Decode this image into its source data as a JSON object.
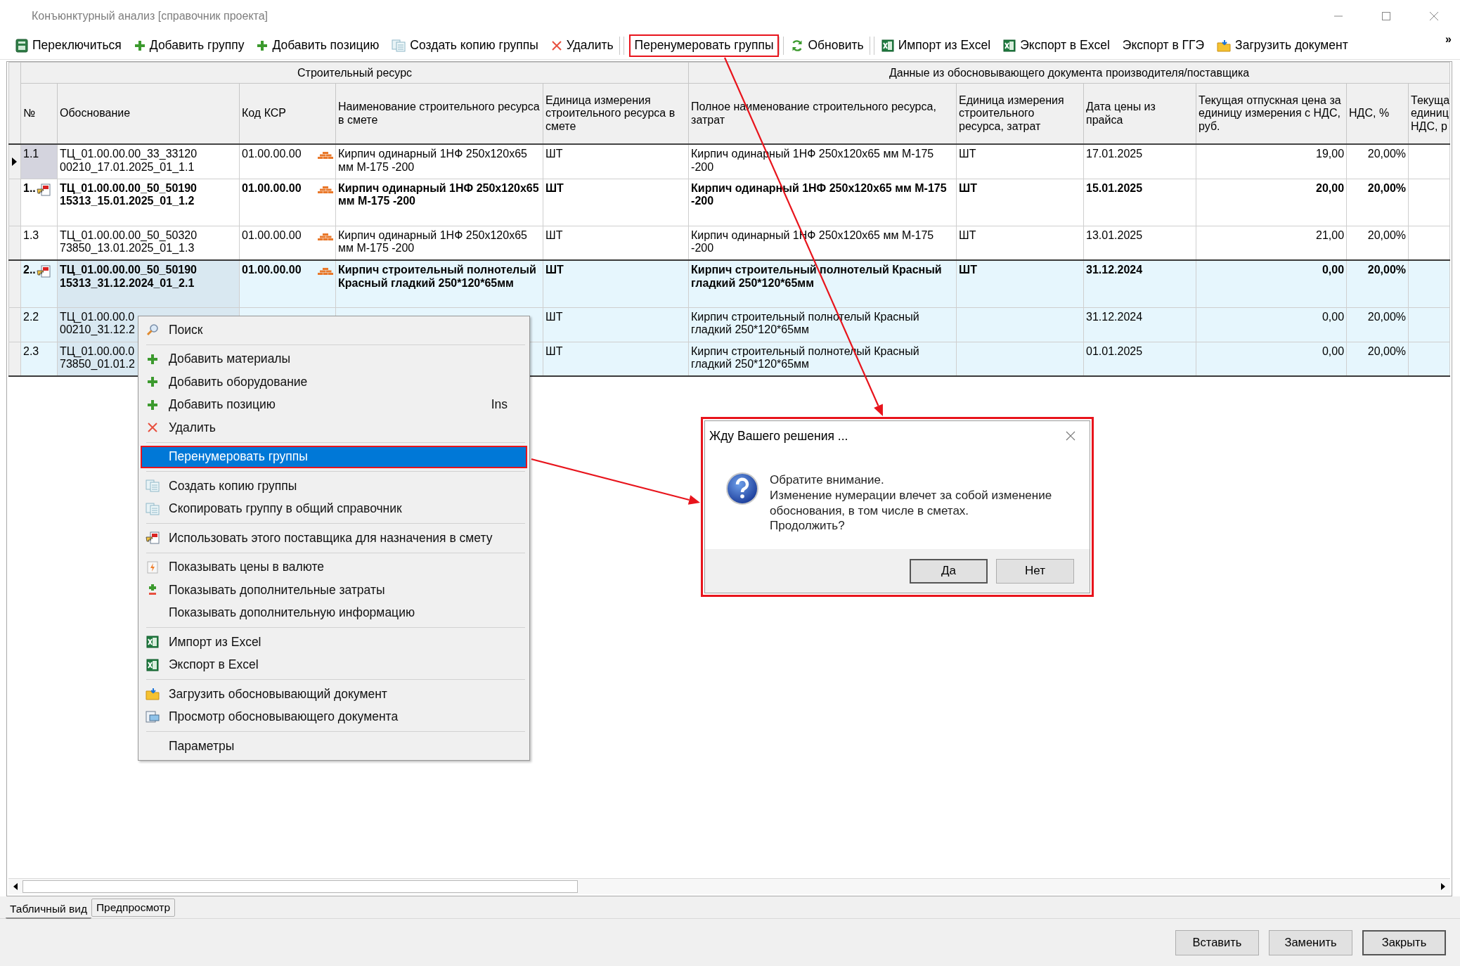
{
  "window": {
    "title": "Конъюнктурный анализ [справочник проекта]"
  },
  "toolbar": {
    "items": [
      {
        "label": "Переключиться",
        "kind": "doc",
        "annotated": false,
        "divider_after": false
      },
      {
        "label": "Добавить группу",
        "kind": "plus",
        "annotated": false,
        "divider_after": false
      },
      {
        "label": "Добавить позицию",
        "kind": "plus",
        "annotated": false,
        "divider_after": false
      },
      {
        "label": "Создать копию группы",
        "kind": "copy",
        "annotated": false,
        "divider_after": false
      },
      {
        "label": "Удалить",
        "kind": "delete",
        "annotated": false,
        "divider_after": true
      },
      {
        "label": "Перенумеровать группы",
        "kind": "text",
        "annotated": true,
        "divider_after": true
      },
      {
        "label": "Обновить",
        "kind": "refresh",
        "annotated": false,
        "divider_after": true
      },
      {
        "label": "Импорт из Excel",
        "kind": "excel",
        "annotated": false,
        "divider_after": false
      },
      {
        "label": "Экспорт в Excel",
        "kind": "excel",
        "annotated": false,
        "divider_after": false
      },
      {
        "label": "Экспорт в ГГЭ",
        "kind": "text",
        "annotated": false,
        "divider_after": false
      },
      {
        "label": "Загрузить документ",
        "kind": "folder",
        "annotated": false,
        "divider_after": false
      }
    ],
    "overflow": "»"
  },
  "table": {
    "column_groups": [
      {
        "label": "Строительный ресурс",
        "columns": [
          "№",
          "Обоснование",
          "Код КСР",
          "Наименование строительного ресурса в смете",
          "Единица измерения строительного ресурса в смете"
        ]
      },
      {
        "label": "Данные из обосновывающего документа производителя/поставщика",
        "columns": [
          "Полное наименование строительного ресурса, затрат",
          "Единица измерения строительного ресурса, затрат",
          "Дата цены из прайса",
          "Текущая отпускная цена за единицу измерения с НДС, руб.",
          "НДС, %",
          "Текуща единиц НДС, р"
        ]
      }
    ],
    "groups": [
      {
        "selected": false,
        "rows": [
          {
            "number": "1.1",
            "current": true,
            "chosen": false,
            "basis": [
              "ТЦ_01.00.00.00_33_33120",
              "00210_17.01.2025_01_1.1"
            ],
            "code": "01.00.00.00",
            "name": "Кирпич одинарный 1НФ 250x120x65 мм М-175 -200",
            "unit": "ШТ",
            "full_name": "Кирпич одинарный 1НФ 250x120x65 мм М-175 -200",
            "unit_2": "ШТ",
            "price_date": "17.01.2025",
            "price": "19,00",
            "vat": "20,00%"
          },
          {
            "number": "1..",
            "current": false,
            "chosen": true,
            "basis": [
              "ТЦ_01.00.00.00_50_50190",
              "15313_15.01.2025_01_1.2"
            ],
            "code": "01.00.00.00",
            "name": "Кирпич одинарный 1НФ 250x120x65 мм М-175 -200",
            "unit": "ШТ",
            "full_name": "Кирпич одинарный 1НФ 250x120x65 мм М-175 -200",
            "unit_2": "ШТ",
            "price_date": "15.01.2025",
            "price": "20,00",
            "vat": "20,00%"
          },
          {
            "number": "1.3",
            "current": false,
            "chosen": false,
            "basis": [
              "ТЦ_01.00.00.00_50_50320",
              "73850_13.01.2025_01_1.3"
            ],
            "code": "01.00.00.00",
            "name": "Кирпич одинарный 1НФ 250x120x65 мм М-175 -200",
            "unit": "ШТ",
            "full_name": "Кирпич одинарный 1НФ 250x120x65 мм М-175 -200",
            "unit_2": "ШТ",
            "price_date": "13.01.2025",
            "price": "21,00",
            "vat": "20,00%"
          }
        ]
      },
      {
        "selected": true,
        "rows": [
          {
            "number": "2..",
            "current": false,
            "chosen": true,
            "basis": [
              "ТЦ_01.00.00.00_50_50190",
              "15313_31.12.2024_01_2.1"
            ],
            "code": "01.00.00.00",
            "name": "Кирпич строительный полнотелый Красный гладкий 250*120*65мм",
            "unit": "ШТ",
            "full_name": "Кирпич строительный полнотелый Красный гладкий 250*120*65мм",
            "unit_2": "ШТ",
            "price_date": "31.12.2024",
            "price": "0,00",
            "vat": "20,00%"
          },
          {
            "number": "2.2",
            "current": false,
            "chosen": false,
            "basis": [
              "ТЦ_01.00.00.0",
              "00210_31.12.2"
            ],
            "unit": "ШТ",
            "full_name": "Кирпич строительный полнотелый Красный гладкий 250*120*65мм",
            "price_date": "31.12.2024",
            "price": "0,00",
            "vat": "20,00%"
          },
          {
            "number": "2.3",
            "current": false,
            "chosen": false,
            "basis": [
              "ТЦ_01.00.00.0",
              "73850_01.01.2"
            ],
            "unit": "ШТ",
            "full_name": "Кирпич строительный полнотелый Красный гладкий 250*120*65мм",
            "price_date": "01.01.2025",
            "price": "0,00",
            "vat": "20,00%"
          }
        ]
      }
    ]
  },
  "context_menu": {
    "sections": [
      [
        {
          "label": "Поиск",
          "kind": "search",
          "selected": false,
          "annotated": false
        }
      ],
      [
        {
          "label": "Добавить материалы",
          "kind": "plus",
          "selected": false,
          "annotated": false
        },
        {
          "label": "Добавить оборудование",
          "kind": "plus",
          "selected": false,
          "annotated": false
        },
        {
          "label": "Добавить позицию",
          "kind": "plus",
          "selected": false,
          "annotated": false,
          "shortcut": "Ins"
        },
        {
          "label": "Удалить",
          "kind": "delete",
          "selected": false,
          "annotated": false
        }
      ],
      [
        {
          "label": "Перенумеровать группы",
          "kind": "text",
          "selected": true,
          "annotated": true
        }
      ],
      [
        {
          "label": "Создать копию группы",
          "kind": "copy",
          "selected": false,
          "annotated": false
        },
        {
          "label": "Скопировать группу в общий справочник",
          "kind": "copy",
          "selected": false,
          "annotated": false
        }
      ],
      [
        {
          "label": "Использовать этого поставщика для назначения в смету",
          "kind": "hand",
          "selected": false,
          "annotated": false
        }
      ],
      [
        {
          "label": "Показывать цены в валюте",
          "kind": "currency",
          "selected": false,
          "annotated": false
        },
        {
          "label": "Показывать дополнительные затраты",
          "kind": "plusminus",
          "selected": false,
          "annotated": false
        },
        {
          "label": "Показывать дополнительную информацию",
          "kind": "text",
          "selected": false,
          "annotated": false
        }
      ],
      [
        {
          "label": "Импорт из Excel",
          "kind": "excel",
          "selected": false,
          "annotated": false
        },
        {
          "label": "Экспорт в Excel",
          "kind": "excel",
          "selected": false,
          "annotated": false
        }
      ],
      [
        {
          "label": "Загрузить обосновывающий документ",
          "kind": "folder",
          "selected": false,
          "annotated": false
        },
        {
          "label": "Просмотр обосновывающего документа",
          "kind": "view",
          "selected": false,
          "annotated": false
        }
      ],
      [
        {
          "label": "Параметры",
          "kind": "text",
          "selected": false,
          "annotated": false
        }
      ]
    ]
  },
  "dialog": {
    "title": "Жду Вашего решения ...",
    "annotated": true,
    "message": [
      "Обратите внимание.",
      "Изменение нумерации влечет за собой изменение",
      "обоснования, в том числе в сметах.",
      "Продолжить?"
    ],
    "buttons": [
      {
        "label": "Да",
        "default": true
      },
      {
        "label": "Нет",
        "default": false
      }
    ]
  },
  "view_tabs": [
    {
      "label": "Табличный вид",
      "selected": true
    },
    {
      "label": "Предпросмотр",
      "selected": false
    }
  ],
  "buttons": [
    {
      "label": "Вставить",
      "default": false
    },
    {
      "label": "Заменить",
      "default": false
    },
    {
      "label": "Закрыть",
      "default": true
    }
  ]
}
